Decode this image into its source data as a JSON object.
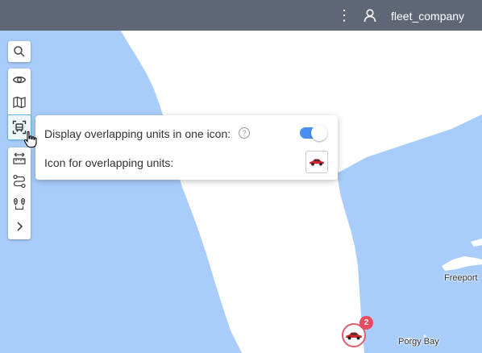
{
  "header": {
    "more_icon": "more-vertical-icon",
    "user_icon": "user-icon",
    "username": "fleet_company"
  },
  "toolbar": {
    "buttons": [
      {
        "icon": "search-icon"
      },
      {
        "icon": "eye-icon"
      },
      {
        "icon": "map-icon"
      },
      {
        "icon": "overlapping-units-icon",
        "active": true
      },
      {
        "icon": "ruler-icon"
      },
      {
        "icon": "route-icon"
      },
      {
        "icon": "locations-icon"
      },
      {
        "icon": "chevron-right-icon"
      }
    ]
  },
  "popup": {
    "overlap_label": "Display overlapping units in one icon:",
    "overlap_help": "?",
    "overlap_enabled": true,
    "icon_label": "Icon for overlapping units:",
    "icon": "red-car-icon"
  },
  "map": {
    "labels": {
      "freeport": "Freeport",
      "porgy_bay": "Porgy Bay"
    },
    "cluster": {
      "count": "2",
      "icon": "red-car-icon"
    },
    "colors": {
      "water": "#a9cdfb",
      "land": "#ffffff",
      "accent": "#4a8ef0",
      "badge": "#e84a5f"
    }
  }
}
